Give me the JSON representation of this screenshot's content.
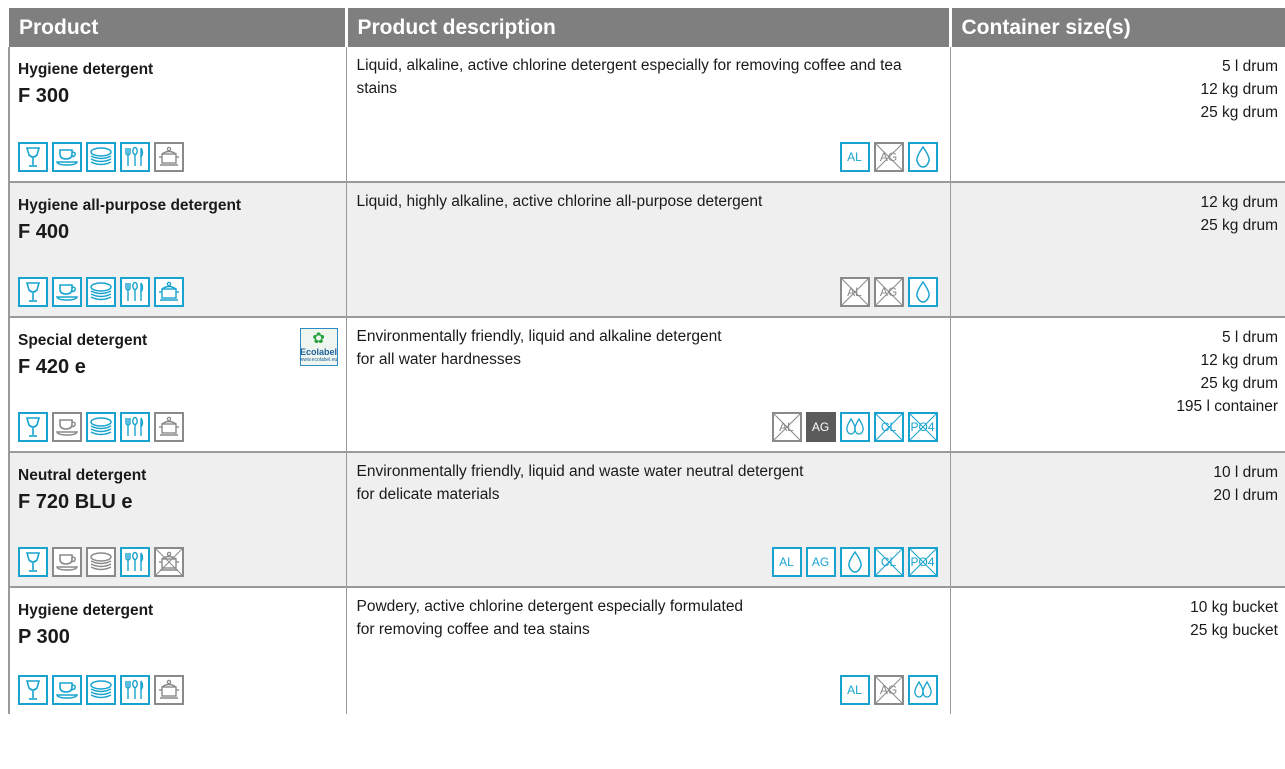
{
  "header": {
    "col_product": "Product",
    "col_description": "Product description",
    "col_sizes": "Container size(s)"
  },
  "colors": {
    "accent_blue": "#18a3cf",
    "grey_icon": "#8a8a8a",
    "header_bg": "#7f7f7f",
    "row_shade": "#efefef"
  },
  "rows": [
    {
      "name": "Hygiene detergent",
      "code": "F 300",
      "description": "Liquid, alkaline, active chlorine detergent especially for removing coffee and tea stains",
      "sizes": [
        "5 l drum",
        "12 kg drum",
        "25 kg drum"
      ],
      "dish_icons": [
        "glass-icon:blue",
        "cup-icon:blue",
        "plates-icon:blue",
        "cutlery-icon:blue",
        "pot-icon:grey"
      ],
      "prop_icons": [
        "AL",
        "AG (crossed)",
        "drop-icon"
      ]
    },
    {
      "name": "Hygiene all-purpose detergent",
      "code": "F 400",
      "description": "Liquid, highly alkaline, active chlorine all-purpose detergent",
      "sizes": [
        "12 kg drum",
        "25 kg drum"
      ],
      "dish_icons": [
        "glass-icon:blue",
        "cup-icon:blue",
        "plates-icon:blue",
        "cutlery-icon:blue",
        "pot-icon:blue"
      ],
      "prop_icons": [
        "AL (crossed)",
        "AG (crossed)",
        "drop-icon"
      ]
    },
    {
      "name": "Special detergent",
      "code": "F 420 e",
      "description_lines": [
        "Environmentally friendly, liquid and alkaline detergent",
        "for all water hardnesses"
      ],
      "ecolabel": {
        "eu": "EU",
        "text": "Ecolabel",
        "url": "www.ecolabel.eu"
      },
      "sizes": [
        "5 l drum",
        "12 kg drum",
        "25 kg drum",
        "195 l container"
      ],
      "dish_icons": [
        "glass-icon:blue",
        "cup-icon:grey",
        "plates-icon:blue",
        "cutlery-icon:blue",
        "pot-icon:grey"
      ],
      "prop_icons": [
        "AL (crossed)",
        "AG",
        "drops-icon",
        "CL (crossed)",
        "PO4 (crossed)"
      ]
    },
    {
      "name": "Neutral detergent",
      "code": "F 720 BLU e",
      "description_lines": [
        "Environmentally friendly, liquid and waste water neutral detergent",
        "for delicate materials"
      ],
      "sizes": [
        "10 l drum",
        "20 l drum"
      ],
      "dish_icons": [
        "glass-icon:blue",
        "cup-icon:grey",
        "plates-icon:grey",
        "cutlery-icon:blue",
        "pot-icon:grey-crossed"
      ],
      "prop_icons": [
        "AL",
        "AG",
        "drop-icon",
        "CL (crossed)",
        "PO4 (crossed)"
      ]
    },
    {
      "name": "Hygiene detergent",
      "code": "P 300",
      "description_lines": [
        "Powdery, active chlorine detergent especially formulated",
        "for removing coffee and tea stains"
      ],
      "sizes": [
        "10 kg bucket",
        "25 kg bucket"
      ],
      "dish_icons": [
        "glass-icon:blue",
        "cup-icon:blue",
        "plates-icon:blue",
        "cutlery-icon:blue",
        "pot-icon:grey"
      ],
      "prop_icons": [
        "AL",
        "AG (crossed)",
        "drops-icon"
      ]
    }
  ],
  "prop_labels": {
    "al": "AL",
    "ag": "AG",
    "cl": "CL",
    "po4": "PO4"
  }
}
